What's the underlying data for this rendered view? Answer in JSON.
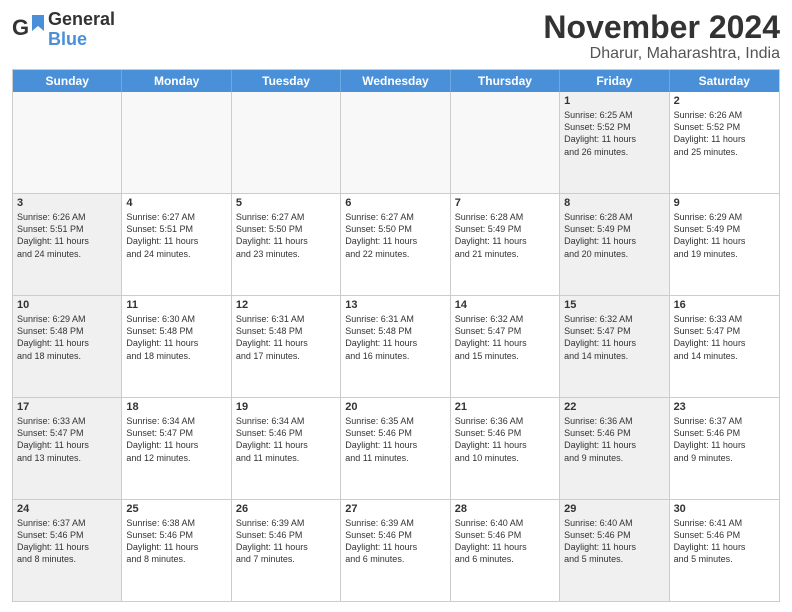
{
  "header": {
    "logo_general": "General",
    "logo_blue": "Blue",
    "month_title": "November 2024",
    "subtitle": "Dharur, Maharashtra, India"
  },
  "weekdays": [
    "Sunday",
    "Monday",
    "Tuesday",
    "Wednesday",
    "Thursday",
    "Friday",
    "Saturday"
  ],
  "rows": [
    [
      {
        "day": "",
        "info": "",
        "empty": true
      },
      {
        "day": "",
        "info": "",
        "empty": true
      },
      {
        "day": "",
        "info": "",
        "empty": true
      },
      {
        "day": "",
        "info": "",
        "empty": true
      },
      {
        "day": "",
        "info": "",
        "empty": true
      },
      {
        "day": "1",
        "info": "Sunrise: 6:25 AM\nSunset: 5:52 PM\nDaylight: 11 hours\nand 26 minutes.",
        "shaded": true
      },
      {
        "day": "2",
        "info": "Sunrise: 6:26 AM\nSunset: 5:52 PM\nDaylight: 11 hours\nand 25 minutes.",
        "shaded": false
      }
    ],
    [
      {
        "day": "3",
        "info": "Sunrise: 6:26 AM\nSunset: 5:51 PM\nDaylight: 11 hours\nand 24 minutes.",
        "shaded": true
      },
      {
        "day": "4",
        "info": "Sunrise: 6:27 AM\nSunset: 5:51 PM\nDaylight: 11 hours\nand 24 minutes.",
        "shaded": false
      },
      {
        "day": "5",
        "info": "Sunrise: 6:27 AM\nSunset: 5:50 PM\nDaylight: 11 hours\nand 23 minutes.",
        "shaded": false
      },
      {
        "day": "6",
        "info": "Sunrise: 6:27 AM\nSunset: 5:50 PM\nDaylight: 11 hours\nand 22 minutes.",
        "shaded": false
      },
      {
        "day": "7",
        "info": "Sunrise: 6:28 AM\nSunset: 5:49 PM\nDaylight: 11 hours\nand 21 minutes.",
        "shaded": false
      },
      {
        "day": "8",
        "info": "Sunrise: 6:28 AM\nSunset: 5:49 PM\nDaylight: 11 hours\nand 20 minutes.",
        "shaded": true
      },
      {
        "day": "9",
        "info": "Sunrise: 6:29 AM\nSunset: 5:49 PM\nDaylight: 11 hours\nand 19 minutes.",
        "shaded": false
      }
    ],
    [
      {
        "day": "10",
        "info": "Sunrise: 6:29 AM\nSunset: 5:48 PM\nDaylight: 11 hours\nand 18 minutes.",
        "shaded": true
      },
      {
        "day": "11",
        "info": "Sunrise: 6:30 AM\nSunset: 5:48 PM\nDaylight: 11 hours\nand 18 minutes.",
        "shaded": false
      },
      {
        "day": "12",
        "info": "Sunrise: 6:31 AM\nSunset: 5:48 PM\nDaylight: 11 hours\nand 17 minutes.",
        "shaded": false
      },
      {
        "day": "13",
        "info": "Sunrise: 6:31 AM\nSunset: 5:48 PM\nDaylight: 11 hours\nand 16 minutes.",
        "shaded": false
      },
      {
        "day": "14",
        "info": "Sunrise: 6:32 AM\nSunset: 5:47 PM\nDaylight: 11 hours\nand 15 minutes.",
        "shaded": false
      },
      {
        "day": "15",
        "info": "Sunrise: 6:32 AM\nSunset: 5:47 PM\nDaylight: 11 hours\nand 14 minutes.",
        "shaded": true
      },
      {
        "day": "16",
        "info": "Sunrise: 6:33 AM\nSunset: 5:47 PM\nDaylight: 11 hours\nand 14 minutes.",
        "shaded": false
      }
    ],
    [
      {
        "day": "17",
        "info": "Sunrise: 6:33 AM\nSunset: 5:47 PM\nDaylight: 11 hours\nand 13 minutes.",
        "shaded": true
      },
      {
        "day": "18",
        "info": "Sunrise: 6:34 AM\nSunset: 5:47 PM\nDaylight: 11 hours\nand 12 minutes.",
        "shaded": false
      },
      {
        "day": "19",
        "info": "Sunrise: 6:34 AM\nSunset: 5:46 PM\nDaylight: 11 hours\nand 11 minutes.",
        "shaded": false
      },
      {
        "day": "20",
        "info": "Sunrise: 6:35 AM\nSunset: 5:46 PM\nDaylight: 11 hours\nand 11 minutes.",
        "shaded": false
      },
      {
        "day": "21",
        "info": "Sunrise: 6:36 AM\nSunset: 5:46 PM\nDaylight: 11 hours\nand 10 minutes.",
        "shaded": false
      },
      {
        "day": "22",
        "info": "Sunrise: 6:36 AM\nSunset: 5:46 PM\nDaylight: 11 hours\nand 9 minutes.",
        "shaded": true
      },
      {
        "day": "23",
        "info": "Sunrise: 6:37 AM\nSunset: 5:46 PM\nDaylight: 11 hours\nand 9 minutes.",
        "shaded": false
      }
    ],
    [
      {
        "day": "24",
        "info": "Sunrise: 6:37 AM\nSunset: 5:46 PM\nDaylight: 11 hours\nand 8 minutes.",
        "shaded": true
      },
      {
        "day": "25",
        "info": "Sunrise: 6:38 AM\nSunset: 5:46 PM\nDaylight: 11 hours\nand 8 minutes.",
        "shaded": false
      },
      {
        "day": "26",
        "info": "Sunrise: 6:39 AM\nSunset: 5:46 PM\nDaylight: 11 hours\nand 7 minutes.",
        "shaded": false
      },
      {
        "day": "27",
        "info": "Sunrise: 6:39 AM\nSunset: 5:46 PM\nDaylight: 11 hours\nand 6 minutes.",
        "shaded": false
      },
      {
        "day": "28",
        "info": "Sunrise: 6:40 AM\nSunset: 5:46 PM\nDaylight: 11 hours\nand 6 minutes.",
        "shaded": false
      },
      {
        "day": "29",
        "info": "Sunrise: 6:40 AM\nSunset: 5:46 PM\nDaylight: 11 hours\nand 5 minutes.",
        "shaded": true
      },
      {
        "day": "30",
        "info": "Sunrise: 6:41 AM\nSunset: 5:46 PM\nDaylight: 11 hours\nand 5 minutes.",
        "shaded": false
      }
    ]
  ]
}
